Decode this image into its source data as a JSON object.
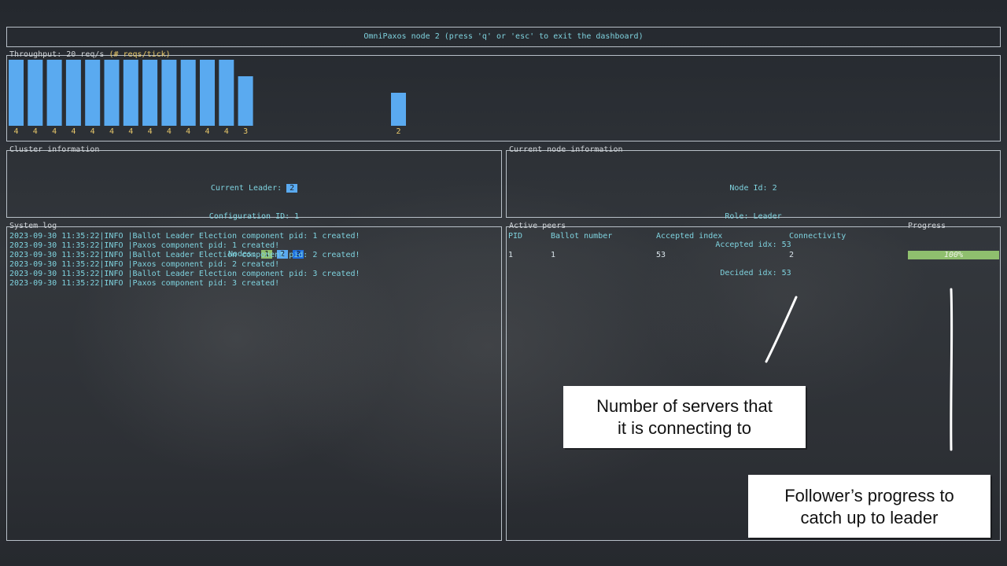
{
  "header": {
    "title": "OmniPaxos node 2 (press 'q' or 'esc' to exit the dashboard)"
  },
  "throughput": {
    "title_main": "Throughput: 20 req/s ",
    "title_hint": "(# reqs/tick)"
  },
  "chart_data": {
    "type": "bar",
    "title": "Throughput: 20 req/s (# reqs/tick)",
    "xlabel": "",
    "ylabel": "",
    "ylim": [
      0,
      4
    ],
    "values": [
      4,
      4,
      4,
      4,
      4,
      4,
      4,
      4,
      4,
      4,
      4,
      4,
      3,
      0,
      0,
      0,
      0,
      0,
      0,
      0,
      2
    ],
    "labels": [
      "4",
      "4",
      "4",
      "4",
      "4",
      "4",
      "4",
      "4",
      "4",
      "4",
      "4",
      "4",
      "3",
      "",
      "",
      "",
      "",
      "",
      "",
      "",
      "2"
    ],
    "bar_color": "#5aaaf0",
    "label_color": "#e8c86a"
  },
  "cluster": {
    "title": "Cluster information",
    "leader_label": "Current Leader: ",
    "leader_value": "2",
    "config_label": "Configuration ID: 1",
    "nodes_label": "Nodes: ",
    "nodes": [
      {
        "id": "1",
        "color": "#8fbf6e"
      },
      {
        "id": "2",
        "color": "#5aaaf0"
      },
      {
        "id": "3",
        "color": "#1e6fe0"
      }
    ]
  },
  "node_info": {
    "title": "Current node information",
    "node_id": "Node Id: 2",
    "role": "Role: Leader",
    "accepted": "Accepted idx: 53",
    "decided": " Decided idx: 53"
  },
  "system_log": {
    "title": "System log",
    "lines": [
      "2023-09-30 11:35:22|INFO |Ballot Leader Election component pid: 1 created!",
      "2023-09-30 11:35:22|INFO |Paxos component pid: 1 created!",
      "2023-09-30 11:35:22|INFO |Ballot Leader Election component pid: 2 created!",
      "2023-09-30 11:35:22|INFO |Paxos component pid: 2 created!",
      "2023-09-30 11:35:22|INFO |Ballot Leader Election component pid: 3 created!",
      "2023-09-30 11:35:22|INFO |Paxos component pid: 3 created!"
    ]
  },
  "peers": {
    "title": "Active peers",
    "progress_title": "Progress",
    "headers": {
      "pid": "PID",
      "ballot": "Ballot number",
      "accepted": "Accepted index",
      "connectivity": "Connectivity"
    },
    "rows": [
      {
        "pid": "1",
        "ballot": "1",
        "accepted": "53",
        "connectivity": "2",
        "progress": "100%",
        "progress_fraction": 1.0
      }
    ]
  },
  "annotations": {
    "connect_line1": "Number of servers that",
    "connect_line2": "it is connecting to",
    "progress_line1": "Follower’s progress to",
    "progress_line2": "catch up to leader"
  }
}
